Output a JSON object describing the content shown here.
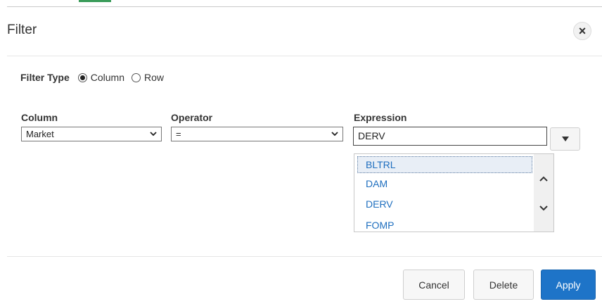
{
  "dialog": {
    "title": "Filter",
    "close_icon": "close-icon"
  },
  "filter_type": {
    "label": "Filter Type",
    "options": [
      {
        "label": "Column",
        "selected": true
      },
      {
        "label": "Row",
        "selected": false
      }
    ]
  },
  "fields": {
    "column": {
      "label": "Column",
      "value": "Market"
    },
    "operator": {
      "label": "Operator",
      "value": "="
    },
    "expression": {
      "label": "Expression",
      "value": "DERV"
    }
  },
  "dropdown": {
    "items": [
      "BLTRL",
      "DAM",
      "DERV",
      "FOMP"
    ],
    "highlighted": "BLTRL"
  },
  "footer": {
    "cancel": "Cancel",
    "delete": "Delete",
    "apply": "Apply"
  },
  "colors": {
    "primary": "#1e74c8",
    "link": "#1f6fbf",
    "accent": "#3b9c5a"
  }
}
